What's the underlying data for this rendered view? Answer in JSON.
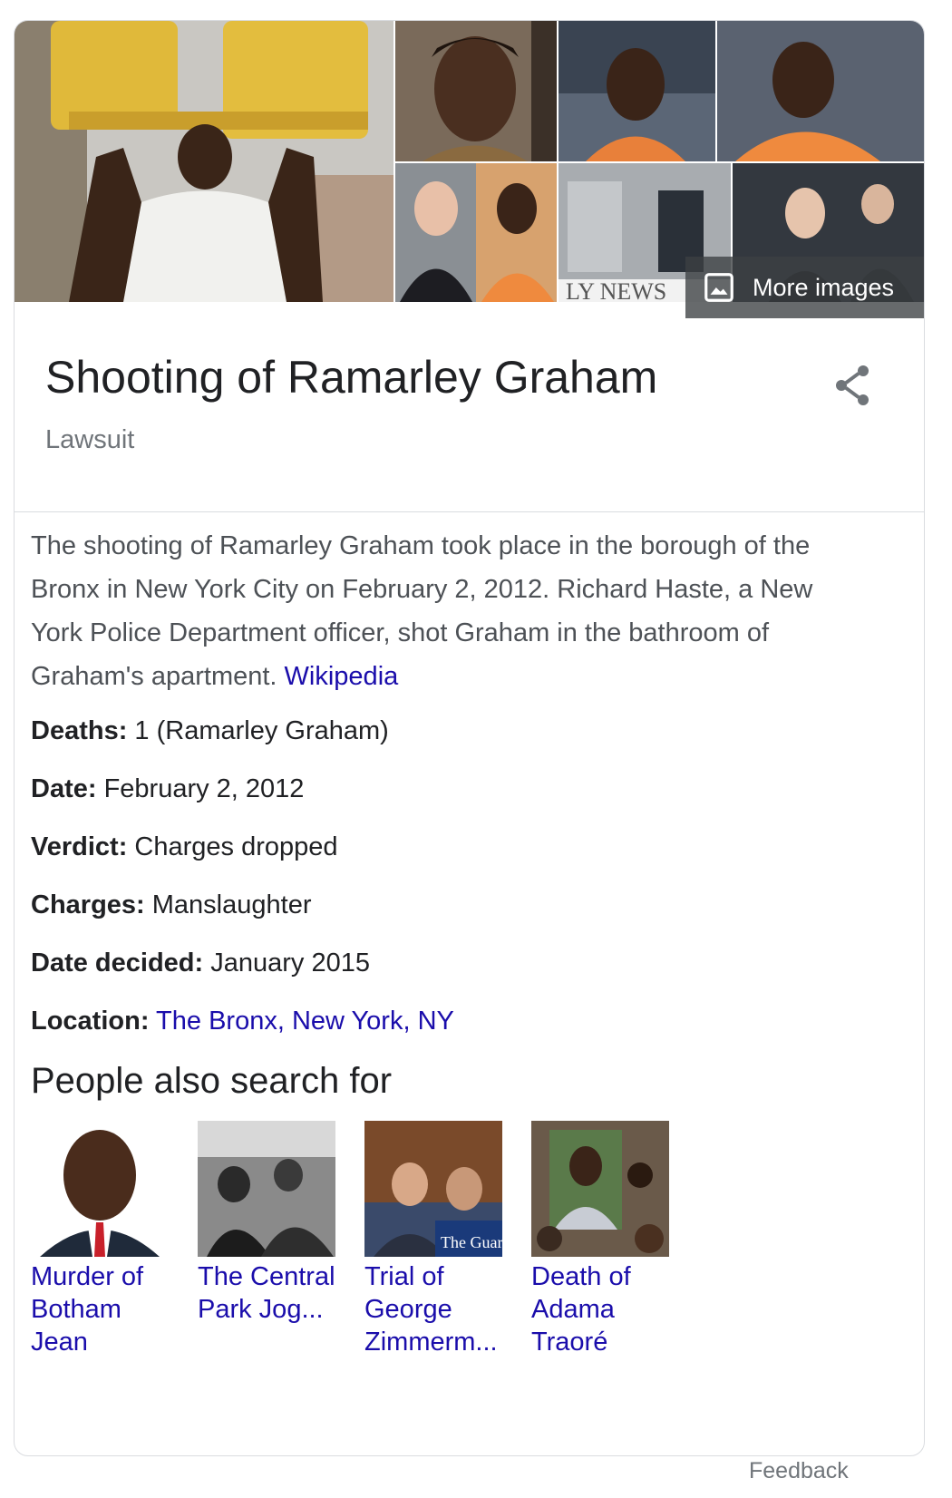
{
  "card": {
    "more_images_label": "More images",
    "title": "Shooting of Ramarley Graham",
    "subtitle": "Lawsuit",
    "description": "The shooting of Ramarley Graham took place in the borough of the Bronx in New York City on February 2, 2012. Richard Haste, a New York Police Department officer, shot Graham in the bathroom of Graham's apartment. ",
    "description_source": "Wikipedia",
    "facts": [
      {
        "key": "Deaths:",
        "value": " 1 (Ramarley Graham)"
      },
      {
        "key": "Date:",
        "value": " February 2, 2012"
      },
      {
        "key": "Verdict:",
        "value": " Charges dropped"
      },
      {
        "key": "Charges:",
        "value": " Manslaughter"
      },
      {
        "key": "Date decided:",
        "value": " January 2015"
      },
      {
        "key": "Location:",
        "value": " ",
        "link": "The Bronx, New York, NY"
      }
    ],
    "people_also_search_title": "People also search for",
    "people_also_search": [
      {
        "label": "Murder of Botham Jean"
      },
      {
        "label": "The Central Park Jog..."
      },
      {
        "label": "Trial of George Zimmerm..."
      },
      {
        "label": "Death of Adama Traoré"
      }
    ],
    "thumb_watermarks": {
      "guardian": "The Guardia",
      "newspaper": "LY NEWS"
    }
  },
  "feedback_label": "Feedback",
  "colors": {
    "link": "#1a0dab",
    "text": "#202124",
    "muted": "#70757a",
    "border": "#dadce0"
  }
}
